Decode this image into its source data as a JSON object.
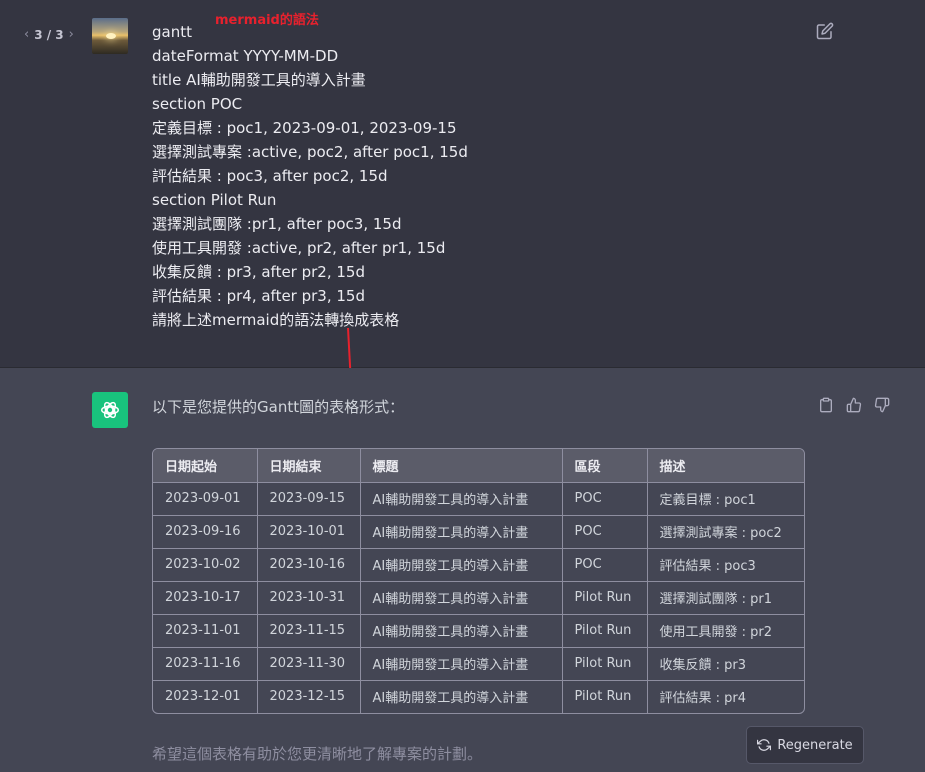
{
  "pager": {
    "prev": "‹",
    "count": "3 / 3",
    "next": "›"
  },
  "annotation": "mermaid的語法",
  "user_message": {
    "lines": [
      "gantt",
      "dateFormat YYYY-MM-DD",
      "title AI輔助開發工具的導入計畫",
      "section POC",
      "定義目標 : poc1, 2023-09-01, 2023-09-15",
      "選擇測試專案 :active, poc2, after poc1, 15d",
      "評估結果 : poc3, after poc2, 15d",
      "section Pilot Run",
      "選擇測試團隊 :pr1, after poc3, 15d",
      "使用工具開發 :active, pr2, after pr1, 15d",
      "收集反饋 : pr3, after pr2, 15d",
      "評估結果 : pr4, after pr3, 15d",
      "請將上述mermaid的語法轉換成表格"
    ]
  },
  "assistant": {
    "intro": "以下是您提供的Gantt圖的表格形式：",
    "outro": "希望這個表格有助於您更清晰地了解專案的計劃。"
  },
  "table": {
    "headers": [
      "日期起始",
      "日期結束",
      "標題",
      "區段",
      "描述"
    ],
    "rows": [
      [
        "2023-09-01",
        "2023-09-15",
        "AI輔助開發工具的導入計畫",
        "POC",
        "定義目標 : poc1"
      ],
      [
        "2023-09-16",
        "2023-10-01",
        "AI輔助開發工具的導入計畫",
        "POC",
        "選擇測試專案 : poc2"
      ],
      [
        "2023-10-02",
        "2023-10-16",
        "AI輔助開發工具的導入計畫",
        "POC",
        "評估結果 : poc3"
      ],
      [
        "2023-10-17",
        "2023-10-31",
        "AI輔助開發工具的導入計畫",
        "Pilot Run",
        "選擇測試團隊 : pr1"
      ],
      [
        "2023-11-01",
        "2023-11-15",
        "AI輔助開發工具的導入計畫",
        "Pilot Run",
        "使用工具開發 : pr2"
      ],
      [
        "2023-11-16",
        "2023-11-30",
        "AI輔助開發工具的導入計畫",
        "Pilot Run",
        "收集反饋 : pr3"
      ],
      [
        "2023-12-01",
        "2023-12-15",
        "AI輔助開發工具的導入計畫",
        "Pilot Run",
        "評估結果 : pr4"
      ]
    ]
  },
  "regenerate": {
    "label": "Regenerate"
  },
  "colors": {
    "user_bg": "#343541",
    "assistant_bg": "#444654",
    "brand_green": "#19c37d",
    "annotation_red": "#e8212d"
  },
  "icons": {
    "prev": "chevron-left-icon",
    "next": "chevron-right-icon",
    "edit": "edit-icon",
    "copy": "clipboard-icon",
    "like": "thumbs-up-icon",
    "dislike": "thumbs-down-icon",
    "regenerate": "refresh-icon",
    "assistant": "openai-logo-icon"
  }
}
